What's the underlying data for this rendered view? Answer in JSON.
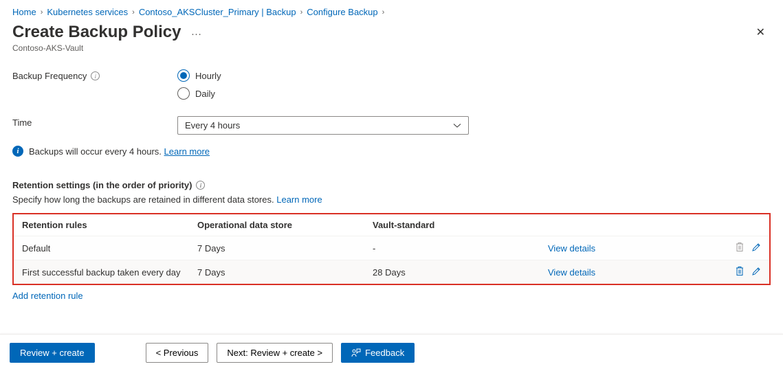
{
  "breadcrumb": {
    "items": [
      "Home",
      "Kubernetes services",
      "Contoso_AKSCluster_Primary | Backup",
      "Configure Backup"
    ]
  },
  "page": {
    "title": "Create Backup Policy",
    "subtitle": "Contoso-AKS-Vault"
  },
  "form": {
    "freq_label": "Backup Frequency",
    "freq_options": {
      "hourly": "Hourly",
      "daily": "Daily"
    },
    "time_label": "Time",
    "time_value": "Every 4 hours"
  },
  "banner": {
    "text": "Backups will occur every 4 hours.",
    "learn": "Learn more"
  },
  "retention": {
    "heading": "Retention settings (in the order of priority)",
    "desc": "Specify how long the backups are retained in different data stores.",
    "learn": "Learn more",
    "cols": {
      "name": "Retention rules",
      "op": "Operational data store",
      "vault": "Vault-standard"
    },
    "rows": [
      {
        "name": "Default",
        "op": "7 Days",
        "vault": "-",
        "view": "View details",
        "delete_enabled": false
      },
      {
        "name": "First successful backup taken every day",
        "op": "7 Days",
        "vault": "28 Days",
        "view": "View details",
        "delete_enabled": true
      }
    ],
    "add": "Add retention rule"
  },
  "footer": {
    "review": "Review + create",
    "prev": "< Previous",
    "next": "Next: Review + create >",
    "feedback": "Feedback"
  }
}
